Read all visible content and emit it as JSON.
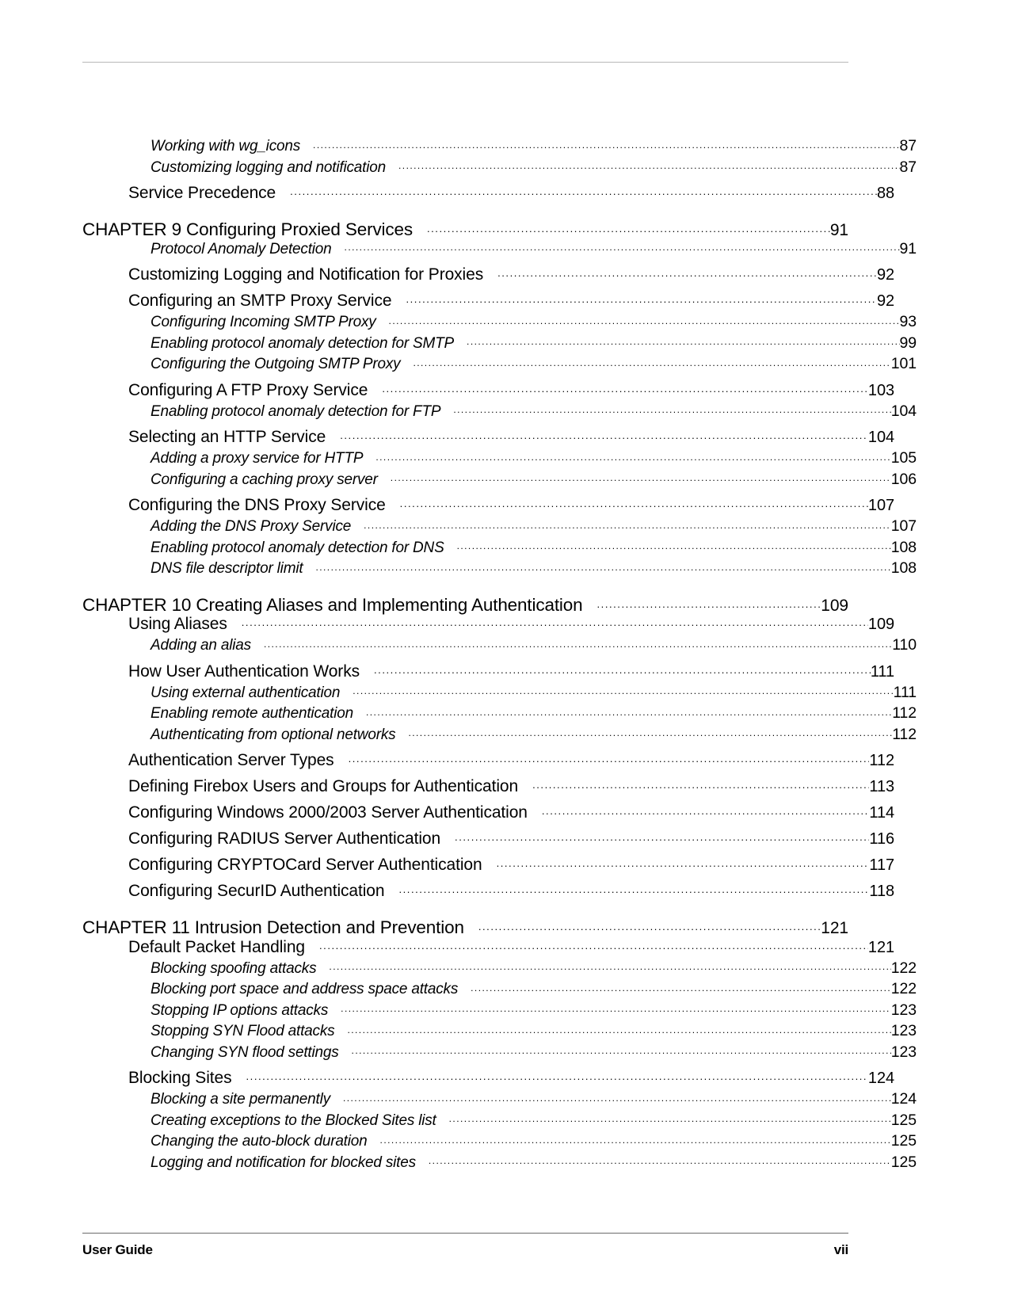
{
  "document": {
    "type": "table-of-contents",
    "footer": {
      "left_label": "User Guide",
      "page_label": "vii"
    }
  },
  "toc": {
    "entries": [
      {
        "level": 2,
        "label": "Working with wg_icons",
        "page": "87"
      },
      {
        "level": 2,
        "label": "Customizing logging and notification",
        "page": "87"
      },
      {
        "level": 1,
        "label": "Service Precedence",
        "page": "88"
      },
      {
        "level": 0,
        "label": "CHAPTER 9  Configuring Proxied Services",
        "page": "91"
      },
      {
        "level": 2,
        "label": "Protocol Anomaly Detection",
        "page": "91"
      },
      {
        "level": 1,
        "label": "Customizing Logging and Notification for Proxies",
        "page": "92"
      },
      {
        "level": 1,
        "label": "Configuring an SMTP Proxy Service",
        "page": "92"
      },
      {
        "level": 2,
        "label": "Configuring Incoming SMTP Proxy",
        "page": "93"
      },
      {
        "level": 2,
        "label": "Enabling protocol anomaly detection for SMTP",
        "page": "99"
      },
      {
        "level": 2,
        "label": "Configuring the Outgoing SMTP Proxy",
        "page": "101"
      },
      {
        "level": 1,
        "label": "Configuring A FTP Proxy Service",
        "page": "103"
      },
      {
        "level": 2,
        "label": "Enabling protocol anomaly detection for FTP",
        "page": "104"
      },
      {
        "level": 1,
        "label": "Selecting an HTTP Service",
        "page": "104"
      },
      {
        "level": 2,
        "label": "Adding a proxy service for HTTP",
        "page": "105"
      },
      {
        "level": 2,
        "label": "Configuring a caching proxy server",
        "page": "106"
      },
      {
        "level": 1,
        "label": "Configuring the DNS Proxy Service",
        "page": "107"
      },
      {
        "level": 2,
        "label": "Adding the DNS Proxy Service",
        "page": "107"
      },
      {
        "level": 2,
        "label": "Enabling protocol anomaly detection for DNS",
        "page": "108"
      },
      {
        "level": 2,
        "label": "DNS file descriptor limit",
        "page": "108"
      },
      {
        "level": 0,
        "label": "CHAPTER 10  Creating Aliases and Implementing Authentication",
        "page": "109"
      },
      {
        "level": 1,
        "label": "Using Aliases",
        "page": "109"
      },
      {
        "level": 2,
        "label": "Adding an alias",
        "page": "110"
      },
      {
        "level": 1,
        "label": "How User Authentication Works",
        "page": "111"
      },
      {
        "level": 2,
        "label": "Using external authentication",
        "page": "111"
      },
      {
        "level": 2,
        "label": "Enabling remote authentication",
        "page": "112"
      },
      {
        "level": 2,
        "label": "Authenticating from optional networks",
        "page": "112"
      },
      {
        "level": 1,
        "label": "Authentication Server Types",
        "page": "112"
      },
      {
        "level": 1,
        "label": "Defining Firebox Users and Groups for Authentication",
        "page": "113"
      },
      {
        "level": 1,
        "label": "Configuring Windows 2000/2003 Server Authentication",
        "page": "114"
      },
      {
        "level": 1,
        "label": "Configuring RADIUS Server Authentication",
        "page": "116"
      },
      {
        "level": 1,
        "label": "Configuring CRYPTOCard Server Authentication",
        "page": "117"
      },
      {
        "level": 1,
        "label": "Configuring SecurID Authentication",
        "page": "118"
      },
      {
        "level": 0,
        "label": "CHAPTER 11  Intrusion Detection and Prevention",
        "page": "121"
      },
      {
        "level": 1,
        "label": "Default Packet Handling",
        "page": "121"
      },
      {
        "level": 2,
        "label": "Blocking spoofing attacks",
        "page": "122"
      },
      {
        "level": 2,
        "label": "Blocking port space and address space attacks",
        "page": "122"
      },
      {
        "level": 2,
        "label": "Stopping IP options attacks",
        "page": "123"
      },
      {
        "level": 2,
        "label": "Stopping SYN Flood attacks",
        "page": "123"
      },
      {
        "level": 2,
        "label": "Changing SYN flood settings",
        "page": "123"
      },
      {
        "level": 1,
        "label": "Blocking Sites",
        "page": "124"
      },
      {
        "level": 2,
        "label": "Blocking a site permanently",
        "page": "124"
      },
      {
        "level": 2,
        "label": "Creating exceptions to the Blocked Sites list",
        "page": "125"
      },
      {
        "level": 2,
        "label": "Changing the auto-block duration",
        "page": "125"
      },
      {
        "level": 2,
        "label": "Logging and notification for blocked sites",
        "page": "125"
      }
    ]
  }
}
